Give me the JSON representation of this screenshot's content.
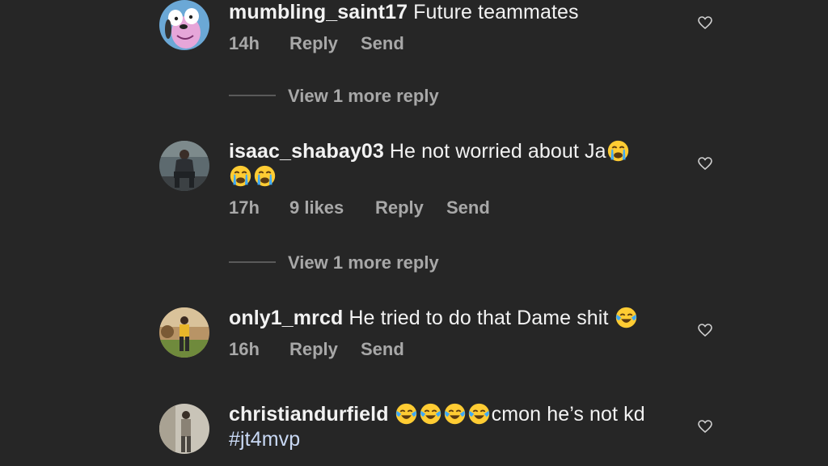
{
  "comments": [
    {
      "username": "mumbling_saint17",
      "text": "Future teammates",
      "time": "14h",
      "likes": "",
      "reply": "Reply",
      "send": "Send",
      "avatar_icon": "cartoon-dog-avatar",
      "view_more": "View 1 more reply"
    },
    {
      "username": "isaac_shabay03",
      "text": "He not worried about Ja",
      "emoji_icon": "loudly-crying-face",
      "time": "17h",
      "likes": "9 likes",
      "reply": "Reply",
      "send": "Send",
      "avatar_icon": "person-sitting-photo",
      "view_more": "View 1 more reply"
    },
    {
      "username": "only1_mrcd",
      "text": "He tried to do that Dame shit",
      "emoji_icon": "face-with-tears-of-joy",
      "time": "16h",
      "likes": "",
      "reply": "Reply",
      "send": "Send",
      "avatar_icon": "person-standing-photo"
    },
    {
      "username": "christiandurfield",
      "text": "cmon he’s not kd",
      "hashtag": "#jt4mvp",
      "emoji_icon": "face-with-tears-of-joy",
      "avatar_icon": "person-mirror-photo"
    }
  ],
  "colors": {
    "background": "#262626",
    "primary_text": "#f2f2f2",
    "secondary_text": "#a8a8a8",
    "hashtag": "#c9d9f5"
  }
}
